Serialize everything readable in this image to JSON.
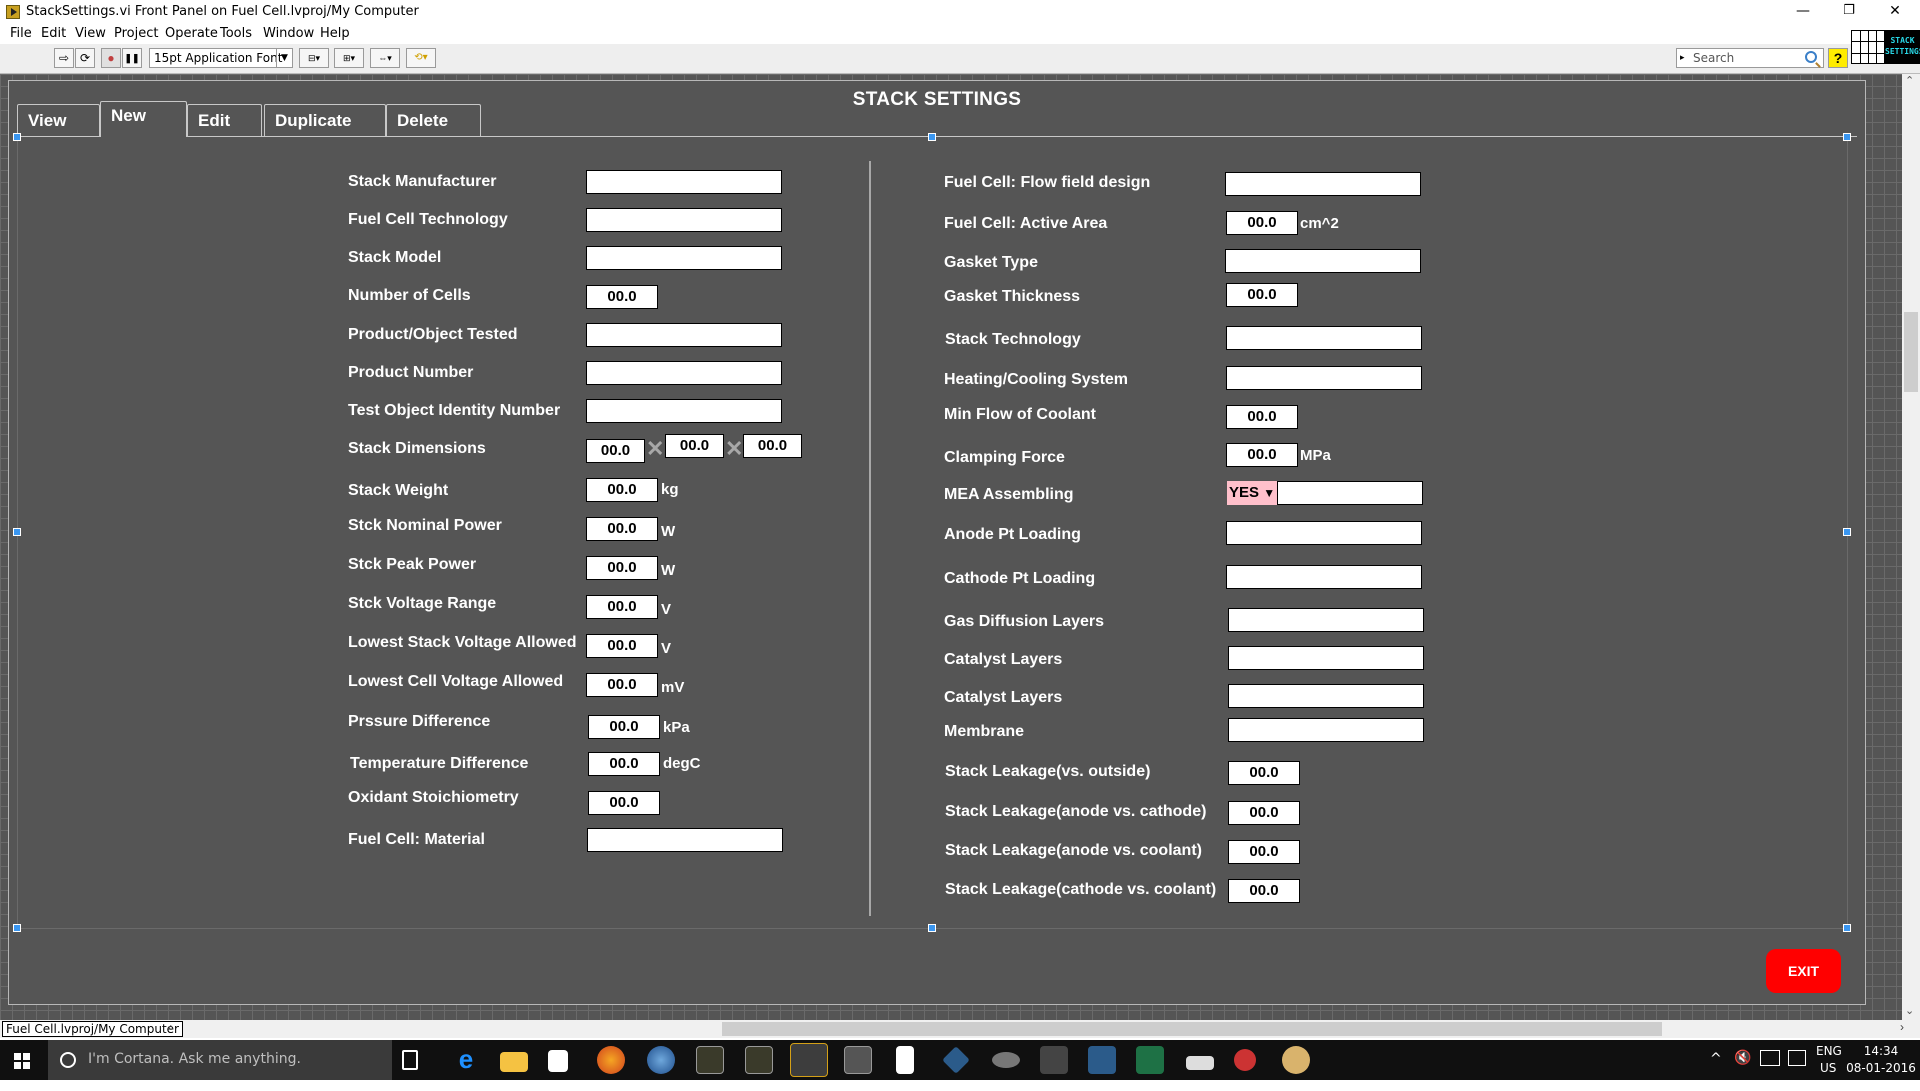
{
  "window": {
    "title": "StackSettings.vi Front Panel on Fuel Cell.lvproj/My Computer",
    "controls": {
      "minimize": "—",
      "restore": "❐",
      "close": "✕"
    }
  },
  "menu": [
    "File",
    "Edit",
    "View",
    "Project",
    "Operate",
    "Tools",
    "Window",
    "Help"
  ],
  "toolbar": {
    "buttons": [
      {
        "name": "run-arrow-icon",
        "glyph": "⇨"
      },
      {
        "name": "run-continuously-icon",
        "glyph": "⟳"
      },
      {
        "name": "abort-icon",
        "glyph": "●"
      },
      {
        "name": "pause-icon",
        "glyph": "❚❚"
      }
    ],
    "font_select": "15pt Application Font",
    "align_buttons": [
      "align-objects-icon",
      "distribute-objects-icon",
      "resize-objects-icon",
      "reorder-icon"
    ],
    "search_placeholder": "Search",
    "help_glyph": "?",
    "vi_icon_caption_1": "STACK",
    "vi_icon_caption_2": "SETTINGS"
  },
  "panel": {
    "title": "STACK SETTINGS",
    "tabs": [
      {
        "label": "View",
        "active": false
      },
      {
        "label": "New",
        "active": true
      },
      {
        "label": "Edit",
        "active": false
      },
      {
        "label": "Duplicate",
        "active": false
      },
      {
        "label": "Delete",
        "active": false
      }
    ],
    "left_fields": [
      {
        "label": "Stack Manufacturer",
        "type": "text",
        "value": ""
      },
      {
        "label": "Fuel Cell Technology",
        "type": "text",
        "value": ""
      },
      {
        "label": "Stack Model",
        "type": "text",
        "value": ""
      },
      {
        "label": "Number of Cells",
        "type": "number",
        "value": "00.0",
        "unit": ""
      },
      {
        "label": "Product/Object Tested",
        "type": "text",
        "value": ""
      },
      {
        "label": "Product Number",
        "type": "text",
        "value": ""
      },
      {
        "label": "Test Object Identity Number",
        "type": "text",
        "value": ""
      },
      {
        "label": "Stack Dimensions",
        "type": "dimensions",
        "values": [
          "00.0",
          "00.0",
          "00.0"
        ],
        "separator": "✕"
      },
      {
        "label": "Stack Weight",
        "type": "number",
        "value": "00.0",
        "unit": "kg"
      },
      {
        "label": "Stck Nominal Power",
        "type": "number",
        "value": "00.0",
        "unit": "W"
      },
      {
        "label": "Stck Peak Power",
        "type": "number",
        "value": "00.0",
        "unit": "W"
      },
      {
        "label": "Stck Voltage Range",
        "type": "number",
        "value": "00.0",
        "unit": "V"
      },
      {
        "label": "Lowest Stack Voltage Allowed",
        "type": "number",
        "value": "00.0",
        "unit": "V"
      },
      {
        "label": "Lowest Cell Voltage Allowed",
        "type": "number",
        "value": "00.0",
        "unit": "mV"
      },
      {
        "label": "Prssure Difference",
        "type": "number",
        "value": "00.0",
        "unit": "kPa"
      },
      {
        "label": "Temperature Difference",
        "type": "number",
        "value": "00.0",
        "unit": "degC"
      },
      {
        "label": "Oxidant Stoichiometry",
        "type": "number",
        "value": "00.0",
        "unit": ""
      },
      {
        "label": "Fuel Cell: Material",
        "type": "text",
        "value": ""
      }
    ],
    "right_fields": [
      {
        "label": "Fuel Cell: Flow field design",
        "type": "text",
        "value": ""
      },
      {
        "label": "Fuel Cell: Active Area",
        "type": "number",
        "value": "00.0",
        "unit": "cm^2"
      },
      {
        "label": "Gasket Type",
        "type": "text",
        "value": ""
      },
      {
        "label": "Gasket Thickness",
        "type": "number",
        "value": "00.0",
        "unit": ""
      },
      {
        "label": "Stack Technology",
        "type": "text",
        "value": ""
      },
      {
        "label": "Heating/Cooling System",
        "type": "text",
        "value": ""
      },
      {
        "label": "Min Flow of Coolant",
        "type": "number",
        "value": "00.0",
        "unit": ""
      },
      {
        "label": "Clamping Force",
        "type": "number",
        "value": "00.0",
        "unit": "MPa"
      },
      {
        "label": "MEA Assembling",
        "type": "enum",
        "selected": "YES",
        "value": ""
      },
      {
        "label": "Anode Pt Loading",
        "type": "text",
        "value": ""
      },
      {
        "label": "Cathode Pt Loading",
        "type": "text",
        "value": ""
      },
      {
        "label": "Gas Diffusion Layers",
        "type": "text",
        "value": ""
      },
      {
        "label": "Catalyst Layers",
        "type": "text",
        "value": ""
      },
      {
        "label": "Catalyst Layers",
        "type": "text",
        "value": ""
      },
      {
        "label": "Membrane",
        "type": "text",
        "value": ""
      },
      {
        "label": "Stack Leakage(vs. outside)",
        "type": "number",
        "value": "00.0",
        "unit": ""
      },
      {
        "label": "Stack Leakage(anode vs. cathode)",
        "type": "number",
        "value": "00.0",
        "unit": ""
      },
      {
        "label": "Stack Leakage(anode vs. coolant)",
        "type": "number",
        "value": "00.0",
        "unit": ""
      },
      {
        "label": "Stack Leakage(cathode vs. coolant)",
        "type": "number",
        "value": "00.0",
        "unit": ""
      }
    ],
    "exit_label": "EXIT"
  },
  "status": {
    "project_label": "Fuel Cell.lvproj/My Computer"
  },
  "taskbar": {
    "cortana_placeholder": "I'm Cortana. Ask me anything.",
    "apps": [
      "task-view",
      "edge",
      "file-explorer",
      "store",
      "firefox",
      "thunderbird",
      "labview-vi-1",
      "labview-vi-2",
      "labview-2014",
      "terminal",
      "calculator",
      "virtualbox",
      "gimp",
      "tools",
      "mysql-workbench",
      "excel",
      "network-drive",
      "snipping-tool",
      "paint"
    ],
    "lang_1": "ENG",
    "lang_2": "US",
    "time": "14:34",
    "date": "08-01-2016"
  },
  "colors": {
    "panel_bg": "#555555",
    "exit_button": "#ff0000",
    "enum_bg": "#ffc0cb",
    "selection_handle": "#3a96f0"
  }
}
